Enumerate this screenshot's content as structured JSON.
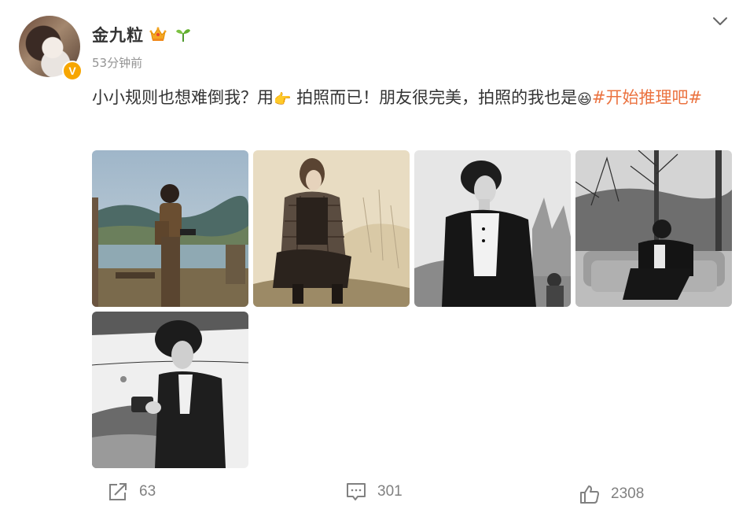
{
  "user": {
    "name": "金九粒",
    "verified_badge": "V",
    "time": "53分钟前"
  },
  "icons": {
    "crown": "crown-icon",
    "sprout": "sprout-icon",
    "more": "chevron-down-icon",
    "hand": "pointing-hand-emoji",
    "laugh": "laughing-face-emoji"
  },
  "post": {
    "text_before": "小小规则也想难倒我？用",
    "text_middle": "拍照而已！朋友很完美，拍照的我也是",
    "hashtag": "#开始推理吧#",
    "hand_emoji": "👉",
    "laugh_emoji": "😆"
  },
  "photos": [
    {
      "label": "photo-1"
    },
    {
      "label": "photo-2"
    },
    {
      "label": "photo-3"
    },
    {
      "label": "photo-4"
    },
    {
      "label": "photo-5"
    }
  ],
  "actions": {
    "repost_count": "63",
    "comment_count": "301",
    "like_count": "2308"
  },
  "colors": {
    "hashtag": "#eb7340",
    "badge": "#f7a600",
    "muted": "#939393"
  }
}
